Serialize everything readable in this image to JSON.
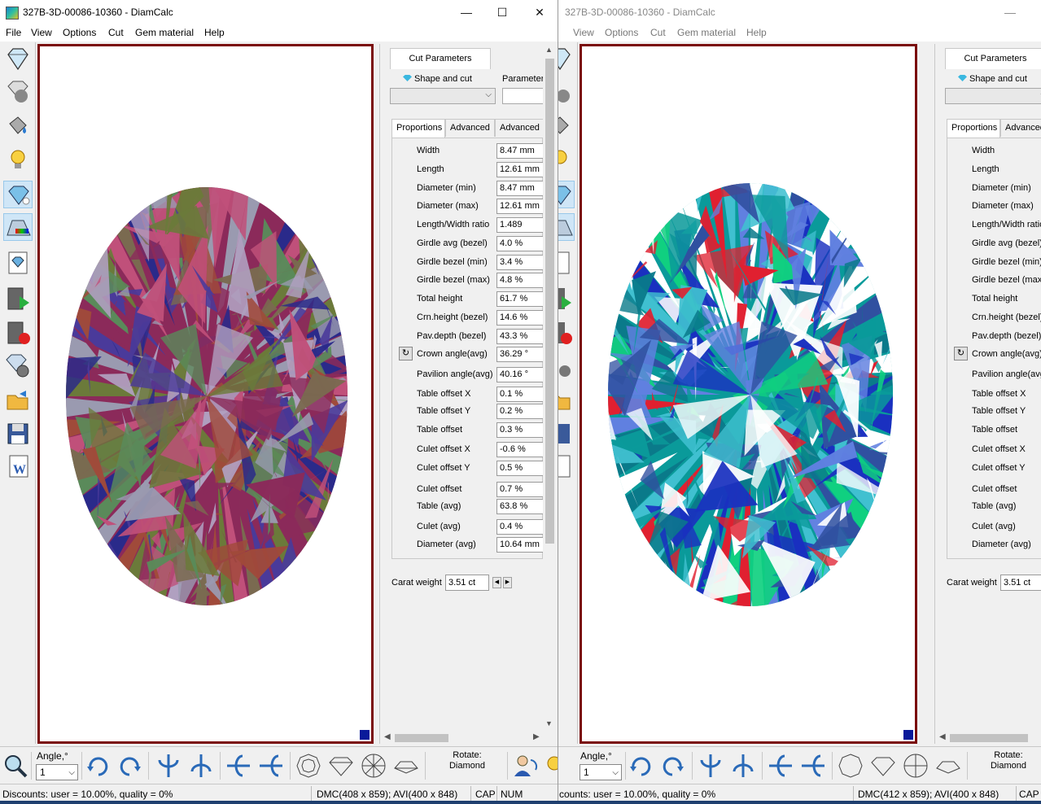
{
  "left_window": {
    "title": "327B-3D-00086-10360 - DiamCalc",
    "controls": {
      "minimize": "—",
      "maximize": "☐",
      "close": "✕"
    },
    "menu": [
      "File",
      "View",
      "Options",
      "Cut",
      "Gem material",
      "Help"
    ],
    "panel": {
      "tab": "Cut Parameters",
      "shape_label": "Shape and cut",
      "params_label": "Parameters",
      "subtabs": [
        "Proportions",
        "Advanced",
        "Advanced ."
      ],
      "rows": [
        {
          "label": "Width",
          "value": "8.47 mm"
        },
        {
          "label": "Length",
          "value": "12.61 mm"
        },
        {
          "label": "Diameter (min)",
          "value": "8.47 mm"
        },
        {
          "label": "Diameter (max)",
          "value": "12.61 mm"
        },
        {
          "label": "Length/Width ratio",
          "value": "1.489"
        },
        {
          "label": "Girdle avg (bezel)",
          "value": "4.0 %"
        },
        {
          "label": "Girdle bezel (min)",
          "value": "3.4 %"
        },
        {
          "label": "Girdle bezel (max)",
          "value": "4.8 %"
        },
        {
          "label": "Total height",
          "value": "61.7 %"
        },
        {
          "label": "Crn.height (bezel)",
          "value": "14.6 %"
        },
        {
          "label": "Pav.depth (bezel)",
          "value": "43.3 %"
        },
        {
          "label": "Crown angle(avg)",
          "value": "36.29 °"
        },
        {
          "label": "Pavilion angle(avg)",
          "value": "40.16 °"
        },
        {
          "label": "Table offset X",
          "value": "0.1 %"
        },
        {
          "label": "Table offset Y",
          "value": "0.2 %"
        },
        {
          "label": "Table offset",
          "value": "0.3 %"
        },
        {
          "label": "Culet offset X",
          "value": "-0.6 %"
        },
        {
          "label": "Culet offset Y",
          "value": "0.5 %"
        },
        {
          "label": "Culet offset",
          "value": "0.7 %"
        },
        {
          "label": "Table (avg)",
          "value": "63.8 %"
        },
        {
          "label": "Culet (avg)",
          "value": "0.4 %"
        },
        {
          "label": "Diameter (avg)",
          "value": "10.64 mm"
        }
      ],
      "carat_label": "Carat weight",
      "carat_value": "3.51 ct"
    },
    "bottom": {
      "angle_label": "Angle,°",
      "angle_value": "1",
      "rotate_line1": "Rotate:",
      "rotate_line2": "Diamond"
    },
    "status": {
      "discounts": "Discounts: user = 10.00%, quality = 0%",
      "dmc": "DMC(408 x 859); AVI(400 x 848)",
      "cap": "CAP",
      "num": "NUM"
    }
  },
  "right_window": {
    "title": "327B-3D-00086-10360 - DiamCalc",
    "controls": {
      "minimize": "—"
    },
    "menu": [
      "View",
      "Options",
      "Cut",
      "Gem material",
      "Help"
    ],
    "panel": {
      "tab": "Cut Parameters",
      "shape_label": "Shape and cut",
      "subtabs": [
        "Proportions",
        "Advanced"
      ],
      "rows": [
        "Width",
        "Length",
        "Diameter (min)",
        "Diameter (max)",
        "Length/Width ratio",
        "Girdle avg (bezel)",
        "Girdle bezel (min)",
        "Girdle bezel (max)",
        "Total height",
        "Crn.height (bezel)",
        "Pav.depth (bezel)",
        "Crown angle(avg)",
        "Pavilion angle(avg)",
        "Table offset X",
        "Table offset Y",
        "Table offset",
        "Culet offset X",
        "Culet offset Y",
        "Culet offset",
        "Table (avg)",
        "Culet (avg)",
        "Diameter (avg)"
      ],
      "carat_label": "Carat weight",
      "carat_value": "3.51 ct"
    },
    "bottom": {
      "angle_label": "Angle,°",
      "angle_value": "1",
      "rotate_line1": "Rotate:",
      "rotate_line2": "Diamond"
    },
    "status": {
      "discounts": "counts: user = 10.00%, quality = 0%",
      "dmc": "DMC(412 x 859); AVI(400 x 848)",
      "cap": "CAP"
    }
  },
  "colors": {
    "viewport_border": "#7a0a0a",
    "left_palette": [
      "#8b2a5a",
      "#6b7a3a",
      "#4a3a9a",
      "#a04a3a",
      "#9a9ab0",
      "#5a8a5a",
      "#c0507a",
      "#2a2a8a",
      "#b0a0c0",
      "#7a6a50"
    ],
    "right_palette": [
      "#0a9a9a",
      "#10d080",
      "#1a30c0",
      "#ffffff",
      "#e02030",
      "#6080e0",
      "#40c0d0",
      "#0a7a8a",
      "#3050a0",
      "#ffffff"
    ]
  },
  "icons": {
    "left_toolbar": [
      "diamond-icon",
      "gem-sphere-icon",
      "paint-bucket-icon",
      "lightbulb-icon",
      "diamond-sparkle-icon",
      "rainbow-prism-icon",
      "diamond-card-icon",
      "video-play-icon",
      "video-record-icon",
      "diamond-gear-icon",
      "open-folder-icon",
      "save-icon",
      "word-document-icon"
    ],
    "bottom_toolbar": [
      "zoom-icon",
      "rotate-cw-icon",
      "rotate-ccw-icon",
      "flip-vertical-icon",
      "flip-vertical-alt-icon",
      "flip-horizontal-icon",
      "flip-horizontal-alt-icon",
      "view-top-icon",
      "view-side-icon",
      "view-bottom-icon",
      "view-profile-icon"
    ]
  }
}
